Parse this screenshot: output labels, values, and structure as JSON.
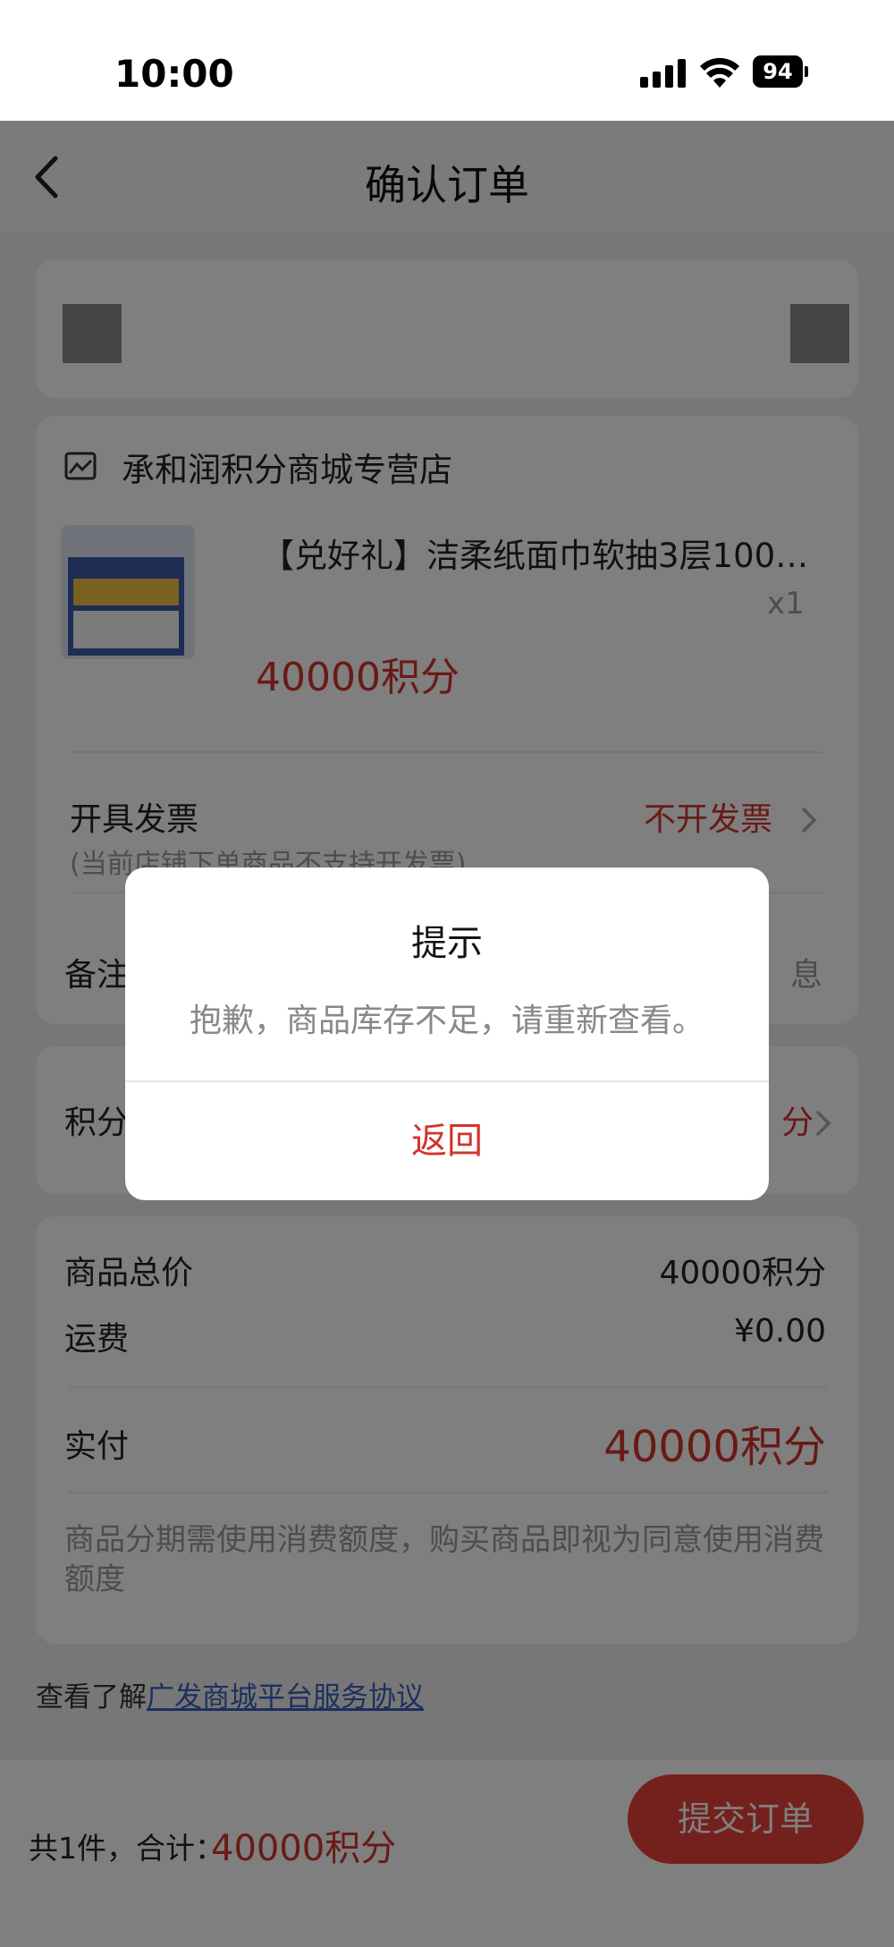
{
  "status_bar": {
    "time": "10:00",
    "battery": "94"
  },
  "nav": {
    "title": "确认订单"
  },
  "store": {
    "name": "承和润积分商城专营店"
  },
  "product": {
    "title": "【兑好礼】洁柔纸面巾软抽3层100…",
    "qty": "x1",
    "price": "40000积分"
  },
  "invoice": {
    "label": "开具发票",
    "note": "(当前店铺下单商品不支持开发票)",
    "value": "不开发票"
  },
  "remark": {
    "label": "备注",
    "hint": "息"
  },
  "points_row": {
    "label": "积分",
    "value_tail": "分"
  },
  "summary": {
    "goods_total_label": "商品总价",
    "goods_total_value": "40000积分",
    "shipping_label": "运费",
    "shipping_value": "¥0.00",
    "paid_label": "实付",
    "paid_value": "40000积分",
    "note": "商品分期需使用消费额度，购买商品即视为同意使用消费额度"
  },
  "agreement": {
    "prefix": "查看了解",
    "link": "广发商城平台服务协议"
  },
  "bottom": {
    "count_label": "共1件，合计：",
    "total": "40000积分",
    "submit": "提交订单"
  },
  "dialog": {
    "title": "提示",
    "message": "抱歉，商品库存不足，请重新查看。",
    "button": "返回"
  },
  "colors": {
    "accent": "#d2342c",
    "link": "#3b5fbf"
  }
}
